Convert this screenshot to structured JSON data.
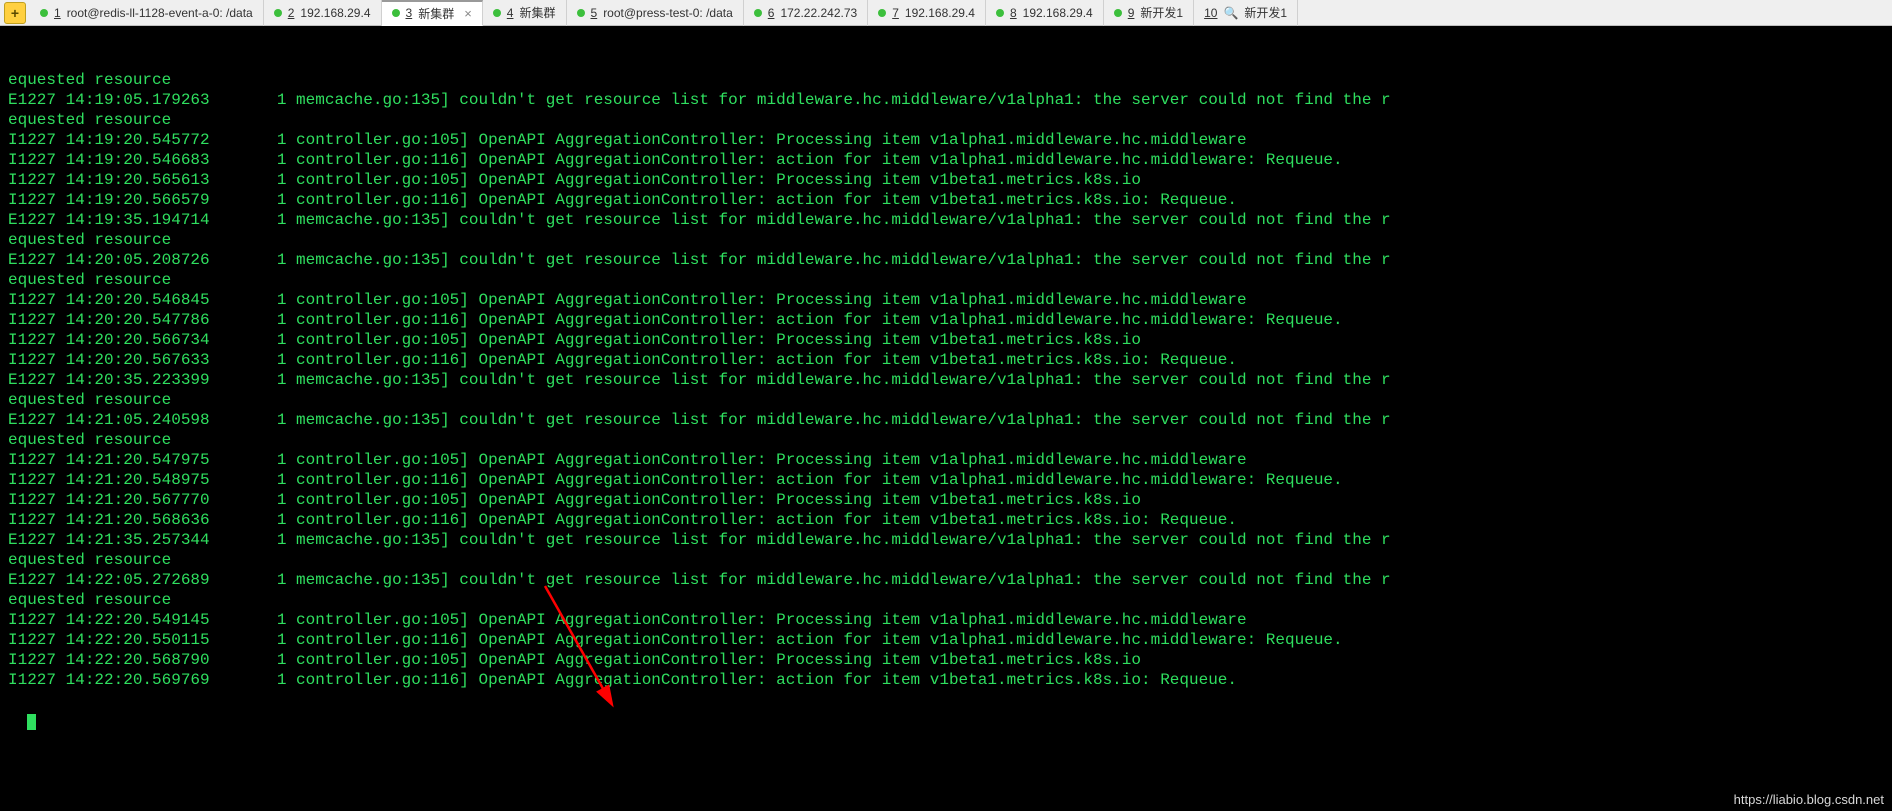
{
  "tabs": [
    {
      "num": "1",
      "label": "root@redis-ll-1128-event-a-0: /data",
      "dot": "green",
      "active": false
    },
    {
      "num": "2",
      "label": "192.168.29.4",
      "dot": "green",
      "active": false
    },
    {
      "num": "3",
      "label": "新集群",
      "dot": "green",
      "active": true
    },
    {
      "num": "4",
      "label": "新集群",
      "dot": "green",
      "active": false
    },
    {
      "num": "5",
      "label": "root@press-test-0: /data",
      "dot": "green",
      "active": false
    },
    {
      "num": "6",
      "label": "172.22.242.73",
      "dot": "green",
      "active": false
    },
    {
      "num": "7",
      "label": "192.168.29.4",
      "dot": "green",
      "active": false
    },
    {
      "num": "8",
      "label": "192.168.29.4",
      "dot": "green",
      "active": false
    },
    {
      "num": "9",
      "label": "新开发1",
      "dot": "green",
      "active": false
    },
    {
      "num": "10",
      "label": "新开发1",
      "dot": "gray",
      "active": false
    }
  ],
  "terminal_lines": [
    "equested resource",
    "E1227 14:19:05.179263       1 memcache.go:135] couldn't get resource list for middleware.hc.middleware/v1alpha1: the server could not find the r",
    "equested resource",
    "I1227 14:19:20.545772       1 controller.go:105] OpenAPI AggregationController: Processing item v1alpha1.middleware.hc.middleware",
    "I1227 14:19:20.546683       1 controller.go:116] OpenAPI AggregationController: action for item v1alpha1.middleware.hc.middleware: Requeue.",
    "I1227 14:19:20.565613       1 controller.go:105] OpenAPI AggregationController: Processing item v1beta1.metrics.k8s.io",
    "I1227 14:19:20.566579       1 controller.go:116] OpenAPI AggregationController: action for item v1beta1.metrics.k8s.io: Requeue.",
    "E1227 14:19:35.194714       1 memcache.go:135] couldn't get resource list for middleware.hc.middleware/v1alpha1: the server could not find the r",
    "equested resource",
    "E1227 14:20:05.208726       1 memcache.go:135] couldn't get resource list for middleware.hc.middleware/v1alpha1: the server could not find the r",
    "equested resource",
    "I1227 14:20:20.546845       1 controller.go:105] OpenAPI AggregationController: Processing item v1alpha1.middleware.hc.middleware",
    "I1227 14:20:20.547786       1 controller.go:116] OpenAPI AggregationController: action for item v1alpha1.middleware.hc.middleware: Requeue.",
    "I1227 14:20:20.566734       1 controller.go:105] OpenAPI AggregationController: Processing item v1beta1.metrics.k8s.io",
    "I1227 14:20:20.567633       1 controller.go:116] OpenAPI AggregationController: action for item v1beta1.metrics.k8s.io: Requeue.",
    "E1227 14:20:35.223399       1 memcache.go:135] couldn't get resource list for middleware.hc.middleware/v1alpha1: the server could not find the r",
    "equested resource",
    "E1227 14:21:05.240598       1 memcache.go:135] couldn't get resource list for middleware.hc.middleware/v1alpha1: the server could not find the r",
    "equested resource",
    "I1227 14:21:20.547975       1 controller.go:105] OpenAPI AggregationController: Processing item v1alpha1.middleware.hc.middleware",
    "I1227 14:21:20.548975       1 controller.go:116] OpenAPI AggregationController: action for item v1alpha1.middleware.hc.middleware: Requeue.",
    "I1227 14:21:20.567770       1 controller.go:105] OpenAPI AggregationController: Processing item v1beta1.metrics.k8s.io",
    "I1227 14:21:20.568636       1 controller.go:116] OpenAPI AggregationController: action for item v1beta1.metrics.k8s.io: Requeue.",
    "E1227 14:21:35.257344       1 memcache.go:135] couldn't get resource list for middleware.hc.middleware/v1alpha1: the server could not find the r",
    "equested resource",
    "E1227 14:22:05.272689       1 memcache.go:135] couldn't get resource list for middleware.hc.middleware/v1alpha1: the server could not find the r",
    "equested resource",
    "I1227 14:22:20.549145       1 controller.go:105] OpenAPI AggregationController: Processing item v1alpha1.middleware.hc.middleware",
    "I1227 14:22:20.550115       1 controller.go:116] OpenAPI AggregationController: action for item v1alpha1.middleware.hc.middleware: Requeue.",
    "I1227 14:22:20.568790       1 controller.go:105] OpenAPI AggregationController: Processing item v1beta1.metrics.k8s.io",
    "I1227 14:22:20.569769       1 controller.go:116] OpenAPI AggregationController: action for item v1beta1.metrics.k8s.io: Requeue."
  ],
  "add_btn_label": "+",
  "close_glyph": "×",
  "search_glyph": "🔍",
  "watermark": "https://liabio.blog.csdn.net"
}
